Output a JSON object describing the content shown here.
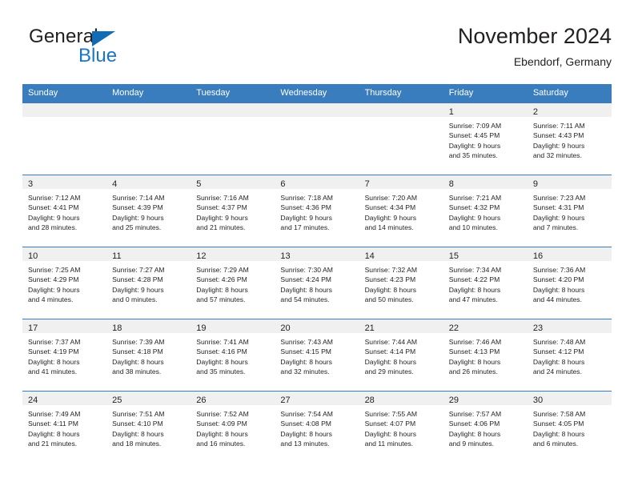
{
  "brand": {
    "name_part1": "General",
    "name_part2": "Blue",
    "triangle_color": "#0f6cb5",
    "blue_color": "#1a76c4"
  },
  "header": {
    "title": "November 2024",
    "subtitle": "Ebendorf, Germany"
  },
  "colors": {
    "header_row_bg": "#3a7dbf",
    "daynum_strip_bg": "#f0f0f0",
    "text": "#231f20",
    "page_bg": "#ffffff"
  },
  "weekday_headers": [
    "Sunday",
    "Monday",
    "Tuesday",
    "Wednesday",
    "Thursday",
    "Friday",
    "Saturday"
  ],
  "weeks": [
    [
      {
        "day": "",
        "empty": true
      },
      {
        "day": "",
        "empty": true
      },
      {
        "day": "",
        "empty": true
      },
      {
        "day": "",
        "empty": true
      },
      {
        "day": "",
        "empty": true
      },
      {
        "day": "1",
        "sunrise": "Sunrise: 7:09 AM",
        "sunset": "Sunset: 4:45 PM",
        "daylight_line1": "Daylight: 9 hours",
        "daylight_line2": "and 35 minutes."
      },
      {
        "day": "2",
        "sunrise": "Sunrise: 7:11 AM",
        "sunset": "Sunset: 4:43 PM",
        "daylight_line1": "Daylight: 9 hours",
        "daylight_line2": "and 32 minutes."
      }
    ],
    [
      {
        "day": "3",
        "sunrise": "Sunrise: 7:12 AM",
        "sunset": "Sunset: 4:41 PM",
        "daylight_line1": "Daylight: 9 hours",
        "daylight_line2": "and 28 minutes."
      },
      {
        "day": "4",
        "sunrise": "Sunrise: 7:14 AM",
        "sunset": "Sunset: 4:39 PM",
        "daylight_line1": "Daylight: 9 hours",
        "daylight_line2": "and 25 minutes."
      },
      {
        "day": "5",
        "sunrise": "Sunrise: 7:16 AM",
        "sunset": "Sunset: 4:37 PM",
        "daylight_line1": "Daylight: 9 hours",
        "daylight_line2": "and 21 minutes."
      },
      {
        "day": "6",
        "sunrise": "Sunrise: 7:18 AM",
        "sunset": "Sunset: 4:36 PM",
        "daylight_line1": "Daylight: 9 hours",
        "daylight_line2": "and 17 minutes."
      },
      {
        "day": "7",
        "sunrise": "Sunrise: 7:20 AM",
        "sunset": "Sunset: 4:34 PM",
        "daylight_line1": "Daylight: 9 hours",
        "daylight_line2": "and 14 minutes."
      },
      {
        "day": "8",
        "sunrise": "Sunrise: 7:21 AM",
        "sunset": "Sunset: 4:32 PM",
        "daylight_line1": "Daylight: 9 hours",
        "daylight_line2": "and 10 minutes."
      },
      {
        "day": "9",
        "sunrise": "Sunrise: 7:23 AM",
        "sunset": "Sunset: 4:31 PM",
        "daylight_line1": "Daylight: 9 hours",
        "daylight_line2": "and 7 minutes."
      }
    ],
    [
      {
        "day": "10",
        "sunrise": "Sunrise: 7:25 AM",
        "sunset": "Sunset: 4:29 PM",
        "daylight_line1": "Daylight: 9 hours",
        "daylight_line2": "and 4 minutes."
      },
      {
        "day": "11",
        "sunrise": "Sunrise: 7:27 AM",
        "sunset": "Sunset: 4:28 PM",
        "daylight_line1": "Daylight: 9 hours",
        "daylight_line2": "and 0 minutes."
      },
      {
        "day": "12",
        "sunrise": "Sunrise: 7:29 AM",
        "sunset": "Sunset: 4:26 PM",
        "daylight_line1": "Daylight: 8 hours",
        "daylight_line2": "and 57 minutes."
      },
      {
        "day": "13",
        "sunrise": "Sunrise: 7:30 AM",
        "sunset": "Sunset: 4:24 PM",
        "daylight_line1": "Daylight: 8 hours",
        "daylight_line2": "and 54 minutes."
      },
      {
        "day": "14",
        "sunrise": "Sunrise: 7:32 AM",
        "sunset": "Sunset: 4:23 PM",
        "daylight_line1": "Daylight: 8 hours",
        "daylight_line2": "and 50 minutes."
      },
      {
        "day": "15",
        "sunrise": "Sunrise: 7:34 AM",
        "sunset": "Sunset: 4:22 PM",
        "daylight_line1": "Daylight: 8 hours",
        "daylight_line2": "and 47 minutes."
      },
      {
        "day": "16",
        "sunrise": "Sunrise: 7:36 AM",
        "sunset": "Sunset: 4:20 PM",
        "daylight_line1": "Daylight: 8 hours",
        "daylight_line2": "and 44 minutes."
      }
    ],
    [
      {
        "day": "17",
        "sunrise": "Sunrise: 7:37 AM",
        "sunset": "Sunset: 4:19 PM",
        "daylight_line1": "Daylight: 8 hours",
        "daylight_line2": "and 41 minutes."
      },
      {
        "day": "18",
        "sunrise": "Sunrise: 7:39 AM",
        "sunset": "Sunset: 4:18 PM",
        "daylight_line1": "Daylight: 8 hours",
        "daylight_line2": "and 38 minutes."
      },
      {
        "day": "19",
        "sunrise": "Sunrise: 7:41 AM",
        "sunset": "Sunset: 4:16 PM",
        "daylight_line1": "Daylight: 8 hours",
        "daylight_line2": "and 35 minutes."
      },
      {
        "day": "20",
        "sunrise": "Sunrise: 7:43 AM",
        "sunset": "Sunset: 4:15 PM",
        "daylight_line1": "Daylight: 8 hours",
        "daylight_line2": "and 32 minutes."
      },
      {
        "day": "21",
        "sunrise": "Sunrise: 7:44 AM",
        "sunset": "Sunset: 4:14 PM",
        "daylight_line1": "Daylight: 8 hours",
        "daylight_line2": "and 29 minutes."
      },
      {
        "day": "22",
        "sunrise": "Sunrise: 7:46 AM",
        "sunset": "Sunset: 4:13 PM",
        "daylight_line1": "Daylight: 8 hours",
        "daylight_line2": "and 26 minutes."
      },
      {
        "day": "23",
        "sunrise": "Sunrise: 7:48 AM",
        "sunset": "Sunset: 4:12 PM",
        "daylight_line1": "Daylight: 8 hours",
        "daylight_line2": "and 24 minutes."
      }
    ],
    [
      {
        "day": "24",
        "sunrise": "Sunrise: 7:49 AM",
        "sunset": "Sunset: 4:11 PM",
        "daylight_line1": "Daylight: 8 hours",
        "daylight_line2": "and 21 minutes."
      },
      {
        "day": "25",
        "sunrise": "Sunrise: 7:51 AM",
        "sunset": "Sunset: 4:10 PM",
        "daylight_line1": "Daylight: 8 hours",
        "daylight_line2": "and 18 minutes."
      },
      {
        "day": "26",
        "sunrise": "Sunrise: 7:52 AM",
        "sunset": "Sunset: 4:09 PM",
        "daylight_line1": "Daylight: 8 hours",
        "daylight_line2": "and 16 minutes."
      },
      {
        "day": "27",
        "sunrise": "Sunrise: 7:54 AM",
        "sunset": "Sunset: 4:08 PM",
        "daylight_line1": "Daylight: 8 hours",
        "daylight_line2": "and 13 minutes."
      },
      {
        "day": "28",
        "sunrise": "Sunrise: 7:55 AM",
        "sunset": "Sunset: 4:07 PM",
        "daylight_line1": "Daylight: 8 hours",
        "daylight_line2": "and 11 minutes."
      },
      {
        "day": "29",
        "sunrise": "Sunrise: 7:57 AM",
        "sunset": "Sunset: 4:06 PM",
        "daylight_line1": "Daylight: 8 hours",
        "daylight_line2": "and 9 minutes."
      },
      {
        "day": "30",
        "sunrise": "Sunrise: 7:58 AM",
        "sunset": "Sunset: 4:05 PM",
        "daylight_line1": "Daylight: 8 hours",
        "daylight_line2": "and 6 minutes."
      }
    ]
  ]
}
